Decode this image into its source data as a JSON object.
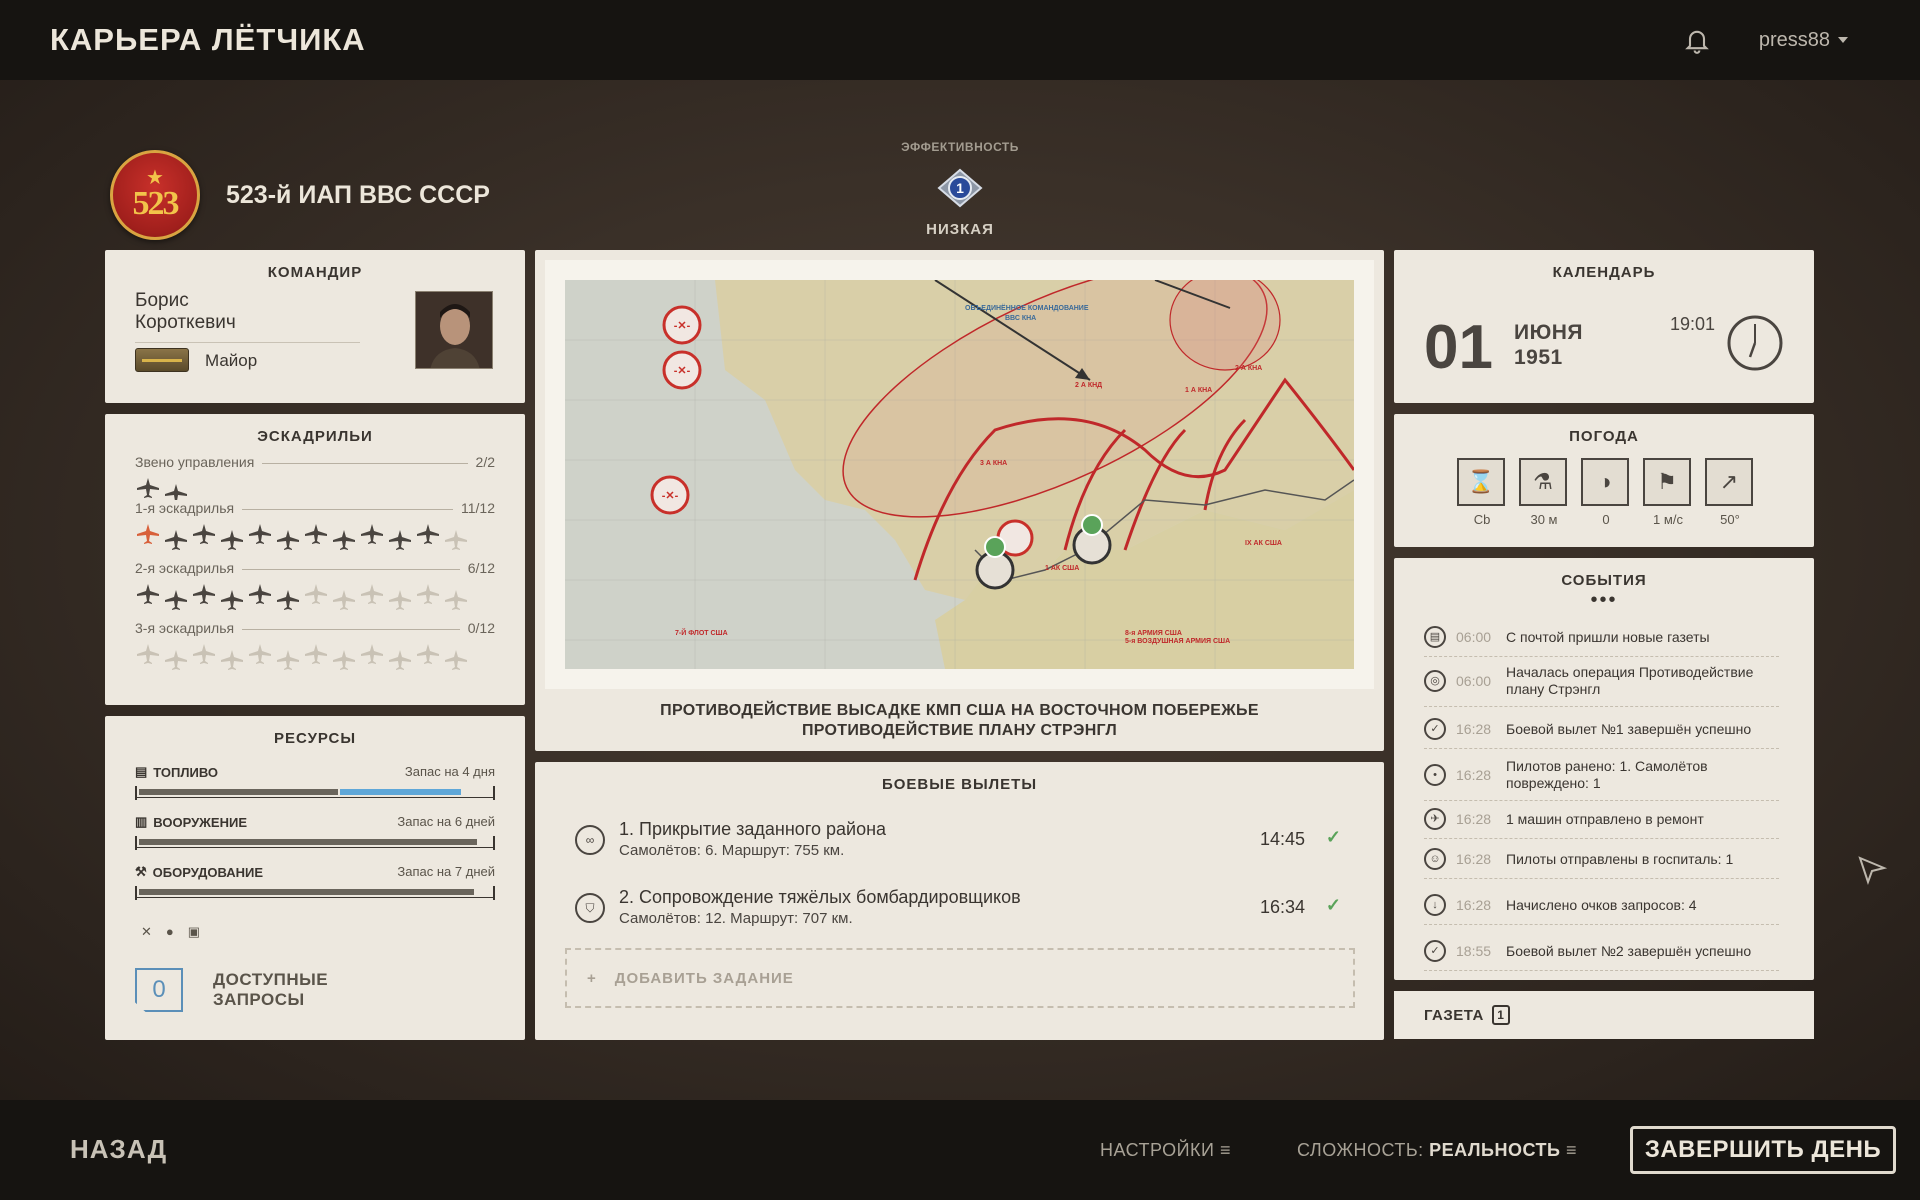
{
  "app": {
    "title": "КАРЬЕРА ЛЁТЧИКА",
    "user": "press88"
  },
  "unit": {
    "emblem_number": "523",
    "name": "523-й ИАП ВВС СССР"
  },
  "efficiency": {
    "label": "ЭФФЕКТИВНОСТЬ",
    "level": "1",
    "value": "НИЗКАЯ"
  },
  "commander": {
    "title": "КОМАНДИР",
    "first_name": "Борис",
    "last_name": "Короткевич",
    "rank": "Майор"
  },
  "squadrons": {
    "title": "ЭСКАДРИЛЬИ",
    "rows": [
      {
        "name": "Звено управления",
        "count": "2/2",
        "active": 2,
        "total": 2
      },
      {
        "name": "1-я эскадрилья",
        "count": "11/12",
        "active": 11,
        "total": 12
      },
      {
        "name": "2-я эскадрилья",
        "count": "6/12",
        "active": 6,
        "total": 12
      },
      {
        "name": "3-я эскадрилья",
        "count": "0/12",
        "active": 0,
        "total": 12
      }
    ]
  },
  "resources": {
    "title": "РЕСУРСЫ",
    "items": [
      {
        "name": "ТОПЛИВО",
        "stock": "Запас на 4 дня",
        "fill": 0.56,
        "extra": 0.34
      },
      {
        "name": "ВООРУЖЕНИЕ",
        "stock": "Запас на 6 дней",
        "fill": 0.95,
        "extra": 0
      },
      {
        "name": "ОБОРУДОВАНИЕ",
        "stock": "Запас на 7 дней",
        "fill": 0.94,
        "extra": 0
      }
    ],
    "requests_count": "0",
    "requests_label_1": "ДОСТУПНЫЕ",
    "requests_label_2": "ЗАПРОСЫ"
  },
  "operation": {
    "line1": "ПРОТИВОДЕЙСТВИЕ ВЫСАДКЕ КМП США НА ВОСТОЧНОМ ПОБЕРЕЖЬЕ",
    "line2": "ПРОТИВОДЕЙСТВИЕ ПЛАНУ СТРЭНГЛ"
  },
  "map_labels": {
    "hq": "ОБЪЕДИНЁННОЕ КОМАНДОВАНИЕ",
    "hq2": "ВВС КНА",
    "fleet": "7-Й ФЛОТ США",
    "army8": "8-я АРМИЯ США",
    "army5": "5-я ВОЗДУШНАЯ АРМИЯ США",
    "corps1": "1 АК США",
    "corps9": "IX АК США",
    "kna1": "2 А КНД",
    "kna2": "1 А КНА",
    "kna3": "3 А КНА",
    "kna4": "2 А КНА"
  },
  "sorties": {
    "title": "БОЕВЫЕ ВЫЛЕТЫ",
    "items": [
      {
        "title": "1. Прикрытие заданного района",
        "sub": "Самолётов: 6. Маршрут: 755 км.",
        "time": "14:45"
      },
      {
        "title": "2. Сопровождение тяжёлых бомбардировщиков",
        "sub": "Самолётов: 12. Маршрут: 707 км.",
        "time": "16:34"
      }
    ],
    "add_label": "ДОБАВИТЬ ЗАДАНИЕ"
  },
  "calendar": {
    "title": "КАЛЕНДАРЬ",
    "day": "01",
    "month": "ИЮНЯ",
    "year": "1951",
    "time": "19:01"
  },
  "weather": {
    "title": "ПОГОДА",
    "items": [
      {
        "icon": "cloud-type-icon",
        "value": "Cb"
      },
      {
        "icon": "cloud-height-icon",
        "value": "30 м"
      },
      {
        "icon": "precipitation-icon",
        "value": "0"
      },
      {
        "icon": "wind-speed-icon",
        "value": "1 м/с"
      },
      {
        "icon": "wind-direction-icon",
        "value": "50°"
      }
    ]
  },
  "events": {
    "title": "СОБЫТИЯ",
    "items": [
      {
        "time": "06:00",
        "text": "С почтой пришли новые газеты",
        "icon": "newspaper-icon"
      },
      {
        "time": "06:00",
        "text": "Началась операция Противодействие плану Стрэнгл",
        "icon": "operation-icon"
      },
      {
        "time": "16:28",
        "text": "Боевой вылет №1 завершён успешно",
        "icon": "check-icon"
      },
      {
        "time": "16:28",
        "text": "Пилотов ранено: 1. Самолётов повреждено: 1",
        "icon": "damage-icon"
      },
      {
        "time": "16:28",
        "text": "1 машин отправлено в ремонт",
        "icon": "repair-icon"
      },
      {
        "time": "16:28",
        "text": "Пилоты отправлены в госпиталь: 1",
        "icon": "pilot-icon"
      },
      {
        "time": "16:28",
        "text": "Начислено очков запросов: 4",
        "icon": "request-points-icon"
      },
      {
        "time": "18:55",
        "text": "Боевой вылет №2 завершён успешно",
        "icon": "check-icon"
      }
    ]
  },
  "newspaper": {
    "label": "ГАЗЕТА",
    "count": "1"
  },
  "bottom": {
    "back": "НАЗАД",
    "settings": "НАСТРОЙКИ",
    "difficulty_label": "СЛОЖНОСТЬ:",
    "difficulty_value": "РЕАЛЬНОСТЬ",
    "finish": "ЗАВЕРШИТЬ ДЕНЬ"
  },
  "colors": {
    "accent_blue": "#5fa7d8",
    "success_green": "#5aa35a",
    "enemy_red": "#c8302a"
  }
}
